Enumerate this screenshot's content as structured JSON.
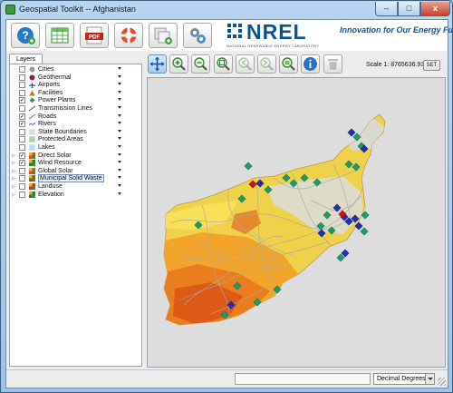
{
  "window": {
    "title": "Geospatial Toolkit -- Afghanistan",
    "controls": {
      "minimize": "–",
      "maximize": "□",
      "close": "x"
    }
  },
  "toolbar": {
    "buttons": [
      {
        "name": "help-button",
        "icon": "help-icon"
      },
      {
        "name": "table-button",
        "icon": "table-icon"
      },
      {
        "name": "pdf-button",
        "icon": "pdf-icon",
        "label": "PDF"
      },
      {
        "name": "support-button",
        "icon": "lifebuoy-icon"
      },
      {
        "name": "add-layer-button",
        "icon": "add-layer-icon"
      },
      {
        "name": "tools-button",
        "icon": "gears-icon"
      }
    ]
  },
  "header": {
    "logo_text": "NREL",
    "logo_subtitle": "NATIONAL RENEWABLE ENERGY LABORATORY",
    "tagline": "Innovation for Our Energy Future",
    "brand_color": "#0a5296"
  },
  "layers": {
    "tab_label": "Layers",
    "items": [
      {
        "label": "Cities",
        "checked": false,
        "expandable": false,
        "icon": "cities-icon",
        "color": "#9a9a9a"
      },
      {
        "label": "Geothermal",
        "checked": false,
        "expandable": false,
        "icon": "geothermal-icon",
        "color": "#8a1a5a"
      },
      {
        "label": "Airports",
        "checked": false,
        "expandable": false,
        "icon": "airport-icon",
        "color": "#3355aa"
      },
      {
        "label": "Facilities",
        "checked": false,
        "expandable": false,
        "icon": "facility-icon",
        "color": "#e0701f"
      },
      {
        "label": "Power Plants",
        "checked": true,
        "expandable": false,
        "icon": "power-plant-icon",
        "color": "#2e9a58"
      },
      {
        "label": "Transmission Lines",
        "checked": false,
        "expandable": false,
        "icon": "line-icon",
        "color": "#555555"
      },
      {
        "label": "Roads",
        "checked": true,
        "expandable": false,
        "icon": "road-icon",
        "color": "#777777"
      },
      {
        "label": "Rivers",
        "checked": true,
        "expandable": false,
        "icon": "river-icon",
        "color": "#3366cc"
      },
      {
        "label": "State Boundaries",
        "checked": false,
        "expandable": false,
        "icon": "boundary-icon",
        "color": "#bbbbbb"
      },
      {
        "label": "Protected Areas",
        "checked": false,
        "expandable": false,
        "icon": "protected-area-icon",
        "color": "#6aa84f"
      },
      {
        "label": "Lakes",
        "checked": false,
        "expandable": false,
        "icon": "lake-icon",
        "color": "#7fb2e6"
      },
      {
        "label": "Direct Solar",
        "checked": true,
        "expandable": true,
        "icon": "solar-raster-icon",
        "color": "#d9541a"
      },
      {
        "label": "Wind Resource",
        "checked": true,
        "expandable": true,
        "icon": "wind-raster-icon",
        "color": "#2f7a3a"
      },
      {
        "label": "Global Solar",
        "checked": false,
        "expandable": true,
        "icon": "solar-raster-icon",
        "color": "#d9541a"
      },
      {
        "label": "Municipal Solid Waste",
        "checked": false,
        "expandable": true,
        "icon": "waste-raster-icon",
        "color": "#8a5a2a",
        "selected": true
      },
      {
        "label": "Landuse",
        "checked": false,
        "expandable": true,
        "icon": "landuse-raster-icon",
        "color": "#c0392b"
      },
      {
        "label": "Elevation",
        "checked": false,
        "expandable": true,
        "icon": "elevation-raster-icon",
        "color": "#2e7d32"
      }
    ]
  },
  "map_toolbar": {
    "tools": [
      {
        "name": "pan-tool",
        "icon": "pan-icon",
        "active": true
      },
      {
        "name": "zoom-in-tool",
        "icon": "zoom-in-icon"
      },
      {
        "name": "zoom-out-tool",
        "icon": "zoom-out-icon"
      },
      {
        "name": "zoom-extent-tool",
        "icon": "zoom-extent-icon"
      },
      {
        "name": "zoom-previous-tool",
        "icon": "zoom-previous-icon",
        "disabled": true
      },
      {
        "name": "zoom-next-tool",
        "icon": "zoom-next-icon",
        "disabled": true
      },
      {
        "name": "zoom-layer-tool",
        "icon": "zoom-layer-icon"
      },
      {
        "name": "identify-tool",
        "icon": "info-icon"
      },
      {
        "name": "clear-tool",
        "icon": "trash-icon",
        "disabled": true
      }
    ],
    "scale_label": "Scale 1: 8765636.93",
    "set_label": "SET"
  },
  "map": {
    "region": "Afghanistan",
    "marker_colors": {
      "power_plant": "#1c9a6a",
      "facility_blue": "#1f2fb0",
      "facility_red": "#d01010"
    }
  },
  "status": {
    "coordinates": "",
    "units": "Decimal Degrees"
  }
}
